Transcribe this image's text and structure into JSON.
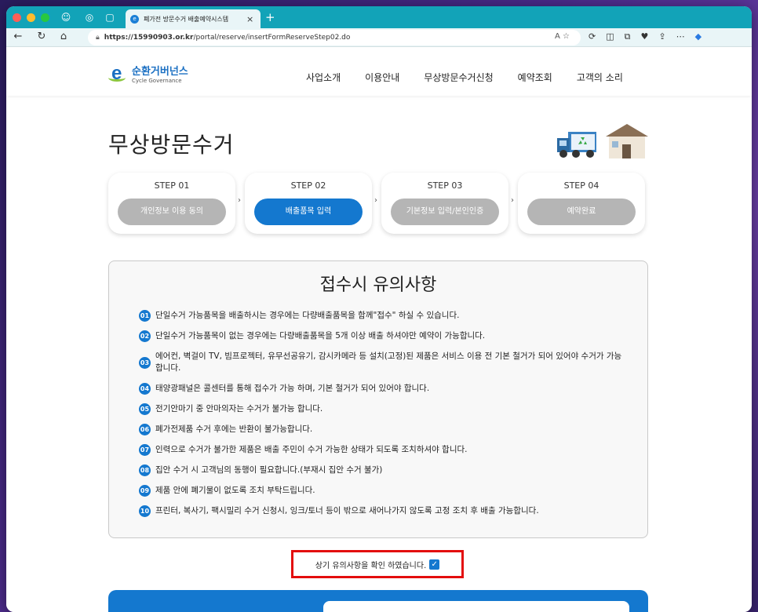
{
  "browser": {
    "tab_title": "폐가전 방문수거 배출예약시스템",
    "url_host": "https://15990903.or.kr",
    "url_path": "/portal/reserve/insertFormReserveStep02.do"
  },
  "site": {
    "logo_kr": "순환거버넌스",
    "logo_en": "Cycle Governance",
    "nav": [
      "사업소개",
      "이용안내",
      "무상방문수거신청",
      "예약조회",
      "고객의 소리"
    ],
    "page_title": "무상방문수거",
    "steps": [
      {
        "label": "STEP 01",
        "pill": "개인정보 이용 동의",
        "active": false
      },
      {
        "label": "STEP 02",
        "pill": "배출품목 입력",
        "active": true
      },
      {
        "label": "STEP 03",
        "pill": "기본정보 입력/본인인증",
        "active": false
      },
      {
        "label": "STEP 04",
        "pill": "예약완료",
        "active": false
      }
    ],
    "notice_title": "접수시 유의사항",
    "notices": [
      {
        "num": "01",
        "text": "단일수거 가능품목을 배출하시는 경우에는 다량배출품목을 함께\"접수\" 하실 수 있습니다."
      },
      {
        "num": "02",
        "text": "단일수거 가능품목이 없는 경우에는 다량배출품목을 5개 이상 배출 하셔야만 예약이 가능합니다."
      },
      {
        "num": "03",
        "text": "에어컨, 벽걸이 TV, 빔프로젝터, 유무선공유기, 감시카메라 등 설치(고정)된 제품은 서비스 이용 전 기본 철거가 되어 있어야 수거가 가능합니다."
      },
      {
        "num": "04",
        "text": "태양광패널은 콜센터를 통해 접수가 가능 하며, 기본 철거가 되어 있어야 합니다."
      },
      {
        "num": "05",
        "text": "전기안마기 중 안마의자는 수거가 불가능 합니다."
      },
      {
        "num": "06",
        "text": "폐가전제품 수거 후에는 반환이 불가능합니다."
      },
      {
        "num": "07",
        "text": "인력으로 수거가 불가한 제품은 배출 주민이 수거 가능한 상태가 되도록 조치하셔야 합니다."
      },
      {
        "num": "08",
        "text": "집안 수거 시 고객님의 동행이 필요합니다.(부재시 집안 수거 불가)"
      },
      {
        "num": "09",
        "text": "제품 안에 폐기물이 없도록 조치 부탁드립니다."
      },
      {
        "num": "10",
        "text": "프린터, 복사기, 팩시밀리 수거 신청시, 잉크/토너 등이 밖으로 새어나가지 않도록 고정 조치 후 배출 가능합니다."
      }
    ],
    "confirm_text": "상기 유의사항을 확인 하였습니다.",
    "confirm_checked": true
  },
  "colors": {
    "accent": "#1478cf",
    "highlight": "#e30d0d",
    "tabbar": "#12a3b8"
  }
}
